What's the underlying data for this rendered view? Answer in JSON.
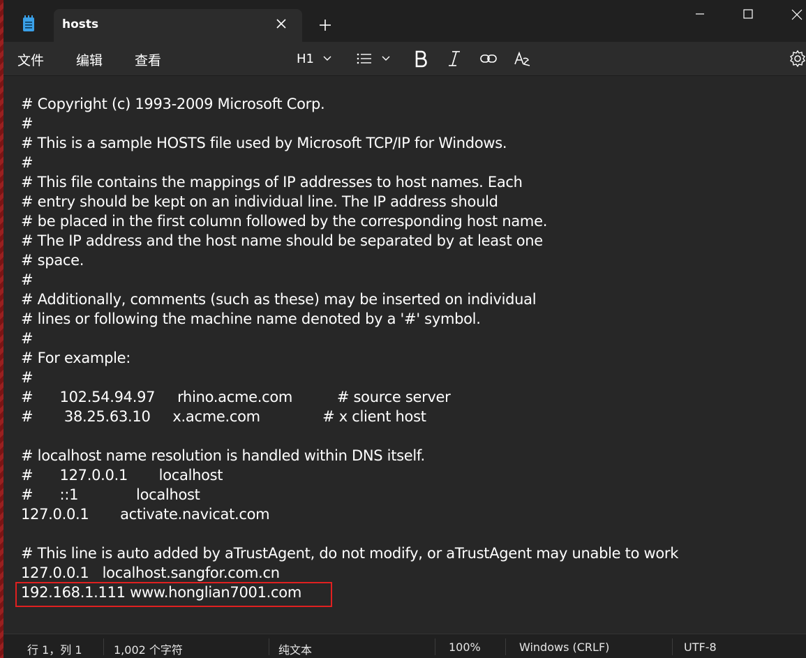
{
  "tab": {
    "title": "hosts"
  },
  "menu": {
    "file": "文件",
    "edit": "编辑",
    "view": "查看"
  },
  "toolbar": {
    "heading": "H1"
  },
  "editor": {
    "lines": [
      "# Copyright (c) 1993-2009 Microsoft Corp.",
      "#",
      "# This is a sample HOSTS file used by Microsoft TCP/IP for Windows.",
      "#",
      "# This file contains the mappings of IP addresses to host names. Each",
      "# entry should be kept on an individual line. The IP address should",
      "# be placed in the first column followed by the corresponding host name.",
      "# The IP address and the host name should be separated by at least one",
      "# space.",
      "#",
      "# Additionally, comments (such as these) may be inserted on individual",
      "# lines or following the machine name denoted by a '#' symbol.",
      "#",
      "# For example:",
      "#",
      "#      102.54.94.97     rhino.acme.com          # source server",
      "#       38.25.63.10     x.acme.com              # x client host",
      "",
      "# localhost name resolution is handled within DNS itself.",
      "#      127.0.0.1       localhost",
      "#      ::1             localhost",
      "127.0.0.1       activate.navicat.com",
      "",
      "# This line is auto added by aTrustAgent, do not modify, or aTrustAgent may unable to work",
      "127.0.0.1   localhost.sangfor.com.cn",
      "192.168.1.111 www.honglian7001.com"
    ]
  },
  "status": {
    "position": "行 1，列 1",
    "chars": "1,002 个字符",
    "format": "纯文本",
    "zoom": "100%",
    "line_ending": "Windows (CRLF)",
    "encoding": "UTF-8"
  },
  "colors": {
    "highlight": "#e02020",
    "background": "#272727"
  }
}
